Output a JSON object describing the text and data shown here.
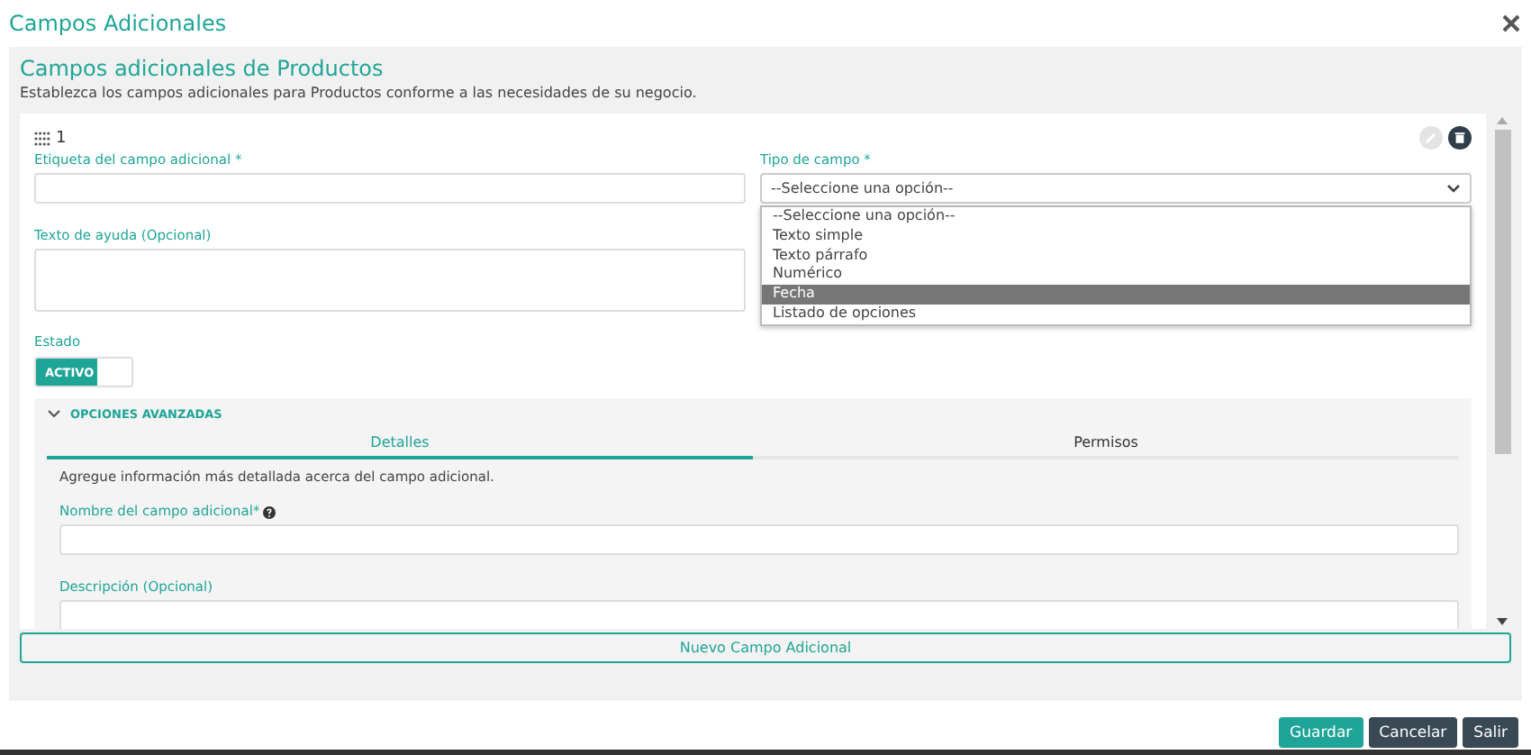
{
  "dialog": {
    "title": "Campos Adicionales"
  },
  "section": {
    "title": "Campos adicionales de Productos",
    "subtitle": "Establezca los campos adicionales para Productos conforme a las necesidades de su negocio."
  },
  "field_card": {
    "number": "1",
    "label_field": {
      "label": "Etiqueta del campo adicional *"
    },
    "type_field": {
      "label": "Tipo de campo *",
      "value": "--Seleccione una opción--",
      "expanded": true,
      "options": [
        {
          "label": "--Seleccione una opción--",
          "highlighted": false
        },
        {
          "label": "Texto simple",
          "highlighted": false
        },
        {
          "label": "Texto párrafo",
          "highlighted": false
        },
        {
          "label": "Numérico",
          "highlighted": false
        },
        {
          "label": "Fecha",
          "highlighted": true
        },
        {
          "label": "Listado de opciones",
          "highlighted": false
        }
      ]
    },
    "help_field": {
      "label": "Texto de ayuda (Opcional)"
    },
    "status": {
      "label": "Estado",
      "toggle_text": "ACTIVO",
      "on": true
    },
    "advanced": {
      "title": "OPCIONES AVANZADAS",
      "expanded": true,
      "tabs": [
        {
          "label": "Detalles",
          "selected": true
        },
        {
          "label": "Permisos",
          "selected": false
        }
      ],
      "description": "Agregue información más detallada acerca del campo adicional.",
      "name_field": {
        "label": "Nombre del campo adicional*"
      },
      "description_field": {
        "label": "Descripción (Opcional)"
      }
    }
  },
  "add_button": "Nuevo Campo Adicional",
  "buttons": [
    {
      "label": "Guardar",
      "kind": "primary"
    },
    {
      "label": "Cancelar",
      "kind": "secondary"
    },
    {
      "label": "Salir",
      "kind": "secondary"
    }
  ]
}
